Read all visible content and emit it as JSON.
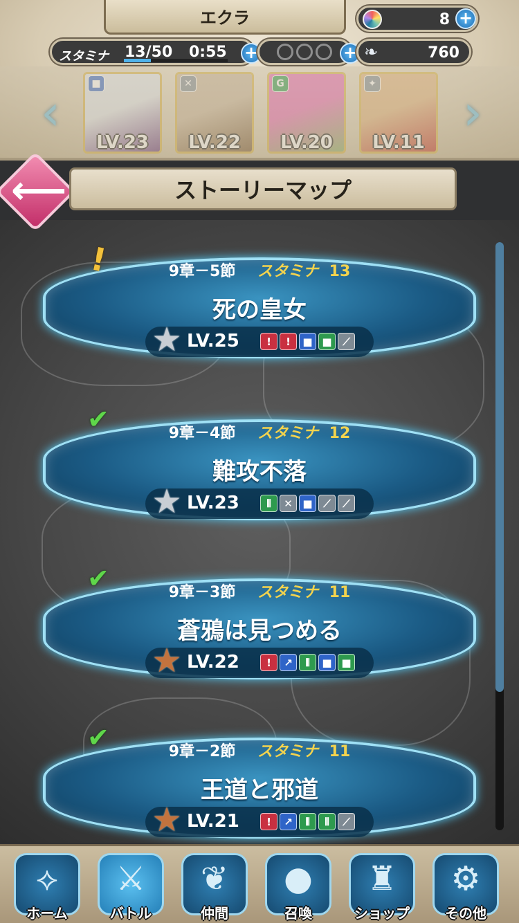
{
  "header": {
    "player_name": "エクラ",
    "orbs": "8",
    "stamina_label": "スタミナ",
    "stamina_value": "13/50",
    "stamina_fraction": 0.26,
    "stamina_timer": "0:55",
    "feathers": "760"
  },
  "heroes": [
    {
      "level": "LV.23",
      "badge": "■",
      "badge_color": "#2f64c8",
      "icon": "tome-blue-icon",
      "portrait_colors": [
        "#e0e6ee",
        "#6b3f85"
      ]
    },
    {
      "level": "LV.22",
      "badge": "✕",
      "badge_color": "#7e8a94",
      "icon": "dagger-icon",
      "portrait_colors": [
        "#c9b59b",
        "#7a5a3a"
      ]
    },
    {
      "level": "LV.20",
      "badge": "G",
      "badge_color": "#2e9a4e",
      "icon": "tome-green-icon",
      "portrait_colors": [
        "#e96bb6",
        "#8ab06a"
      ]
    },
    {
      "level": "LV.11",
      "badge": "✦",
      "badge_color": "#7e8a94",
      "icon": "shuriken-icon",
      "portrait_colors": [
        "#e0b27d",
        "#c23b32"
      ]
    }
  ],
  "page_title": "ストーリーマップ",
  "stages": [
    {
      "status": "alert",
      "chapter": "9章－5節",
      "stamina_label": "スタミナ",
      "stamina_cost": "13",
      "title": "死の皇女",
      "star": "silver",
      "level": "LV.25",
      "weapons": [
        "sword",
        "sword",
        "tome-blue",
        "tome-green",
        "staff"
      ]
    },
    {
      "status": "cleared",
      "chapter": "9章－4節",
      "stamina_label": "スタミナ",
      "stamina_cost": "12",
      "title": "難攻不落",
      "star": "silver",
      "level": "LV.23",
      "weapons": [
        "axe",
        "dagger",
        "tome-blue",
        "bow",
        "staff"
      ]
    },
    {
      "status": "cleared",
      "chapter": "9章－3節",
      "stamina_label": "スタミナ",
      "stamina_cost": "11",
      "title": "蒼鴉は見つめる",
      "star": "bronze",
      "level": "LV.22",
      "weapons": [
        "sword",
        "lance",
        "axe",
        "tome-blue",
        "tome-green"
      ]
    },
    {
      "status": "cleared",
      "chapter": "9章－2節",
      "stamina_label": "スタミナ",
      "stamina_cost": "11",
      "title": "王道と邪道",
      "star": "bronze",
      "level": "LV.21",
      "weapons": [
        "sword",
        "lance",
        "axe",
        "axe",
        "staff"
      ]
    }
  ],
  "nav": [
    {
      "label": "ホーム",
      "icon": "home-icon",
      "active": false
    },
    {
      "label": "バトル",
      "icon": "battle-icon",
      "active": true
    },
    {
      "label": "仲間",
      "icon": "allies-icon",
      "active": false
    },
    {
      "label": "召喚",
      "icon": "summon-icon",
      "active": false
    },
    {
      "label": "ショップ",
      "icon": "shop-icon",
      "active": false
    },
    {
      "label": "その他",
      "icon": "misc-icon",
      "active": false
    }
  ],
  "colors": {
    "accent_blue": "#3a93c0",
    "stamina_gold": "#f3d34e",
    "back_pink": "#c22d68"
  }
}
